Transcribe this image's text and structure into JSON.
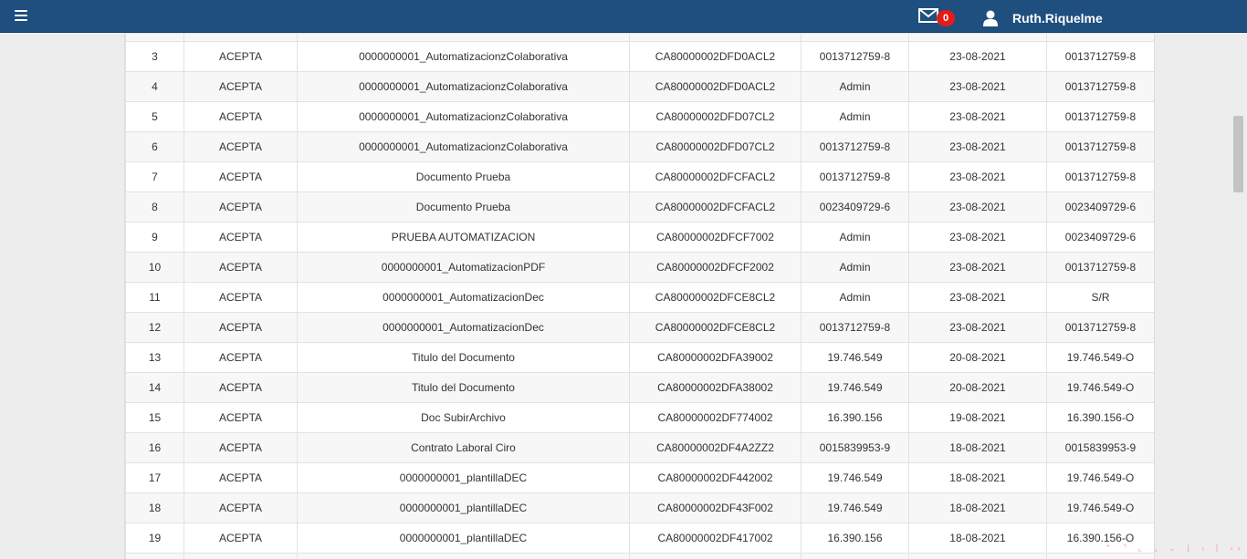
{
  "header": {
    "menu_icon": "hamburger-menu-icon",
    "mail_icon": "envelope-icon",
    "notifications_count": "0",
    "user_icon": "user-icon",
    "username": "Ruth.Riquelme",
    "background_color": "#1e4f7f",
    "badge_color": "#e31b1b"
  },
  "table": {
    "rows": [
      [
        "3",
        "ACEPTA",
        "0000000001_AutomatizacionzColaborativa",
        "CA80000002DFD0ACL2",
        "0013712759-8",
        "23-08-2021",
        "0013712759-8"
      ],
      [
        "4",
        "ACEPTA",
        "0000000001_AutomatizacionzColaborativa",
        "CA80000002DFD0ACL2",
        "Admin",
        "23-08-2021",
        "0013712759-8"
      ],
      [
        "5",
        "ACEPTA",
        "0000000001_AutomatizacionzColaborativa",
        "CA80000002DFD07CL2",
        "Admin",
        "23-08-2021",
        "0013712759-8"
      ],
      [
        "6",
        "ACEPTA",
        "0000000001_AutomatizacionzColaborativa",
        "CA80000002DFD07CL2",
        "0013712759-8",
        "23-08-2021",
        "0013712759-8"
      ],
      [
        "7",
        "ACEPTA",
        "Documento Prueba",
        "CA80000002DFCFACL2",
        "0013712759-8",
        "23-08-2021",
        "0013712759-8"
      ],
      [
        "8",
        "ACEPTA",
        "Documento Prueba",
        "CA80000002DFCFACL2",
        "0023409729-6",
        "23-08-2021",
        "0023409729-6"
      ],
      [
        "9",
        "ACEPTA",
        "PRUEBA AUTOMATIZACION",
        "CA80000002DFCF7002",
        "Admin",
        "23-08-2021",
        "0023409729-6"
      ],
      [
        "10",
        "ACEPTA",
        "0000000001_AutomatizacionPDF",
        "CA80000002DFCF2002",
        "Admin",
        "23-08-2021",
        "0013712759-8"
      ],
      [
        "11",
        "ACEPTA",
        "0000000001_AutomatizacionDec",
        "CA80000002DFCE8CL2",
        "Admin",
        "23-08-2021",
        "S/R"
      ],
      [
        "12",
        "ACEPTA",
        "0000000001_AutomatizacionDec",
        "CA80000002DFCE8CL2",
        "0013712759-8",
        "23-08-2021",
        "0013712759-8"
      ],
      [
        "13",
        "ACEPTA",
        "Titulo del Documento",
        "CA80000002DFA39002",
        "19.746.549",
        "20-08-2021",
        "19.746.549-O"
      ],
      [
        "14",
        "ACEPTA",
        "Titulo del Documento",
        "CA80000002DFA38002",
        "19.746.549",
        "20-08-2021",
        "19.746.549-O"
      ],
      [
        "15",
        "ACEPTA",
        "Doc SubirArchivo",
        "CA80000002DF774002",
        "16.390.156",
        "19-08-2021",
        "16.390.156-O"
      ],
      [
        "16",
        "ACEPTA",
        "Contrato Laboral Ciro",
        "CA80000002DF4A2ZZ2",
        "0015839953-9",
        "18-08-2021",
        "0015839953-9"
      ],
      [
        "17",
        "ACEPTA",
        "0000000001_plantillaDEC",
        "CA80000002DF442002",
        "19.746.549",
        "18-08-2021",
        "19.746.549-O"
      ],
      [
        "18",
        "ACEPTA",
        "0000000001_plantillaDEC",
        "CA80000002DF43F002",
        "19.746.549",
        "18-08-2021",
        "19.746.549-O"
      ],
      [
        "19",
        "ACEPTA",
        "0000000001_plantillaDEC",
        "CA80000002DF417002",
        "16.390.156",
        "18-08-2021",
        "16.390.156-O"
      ]
    ]
  },
  "footer_deco": "⌃ ⌝ ⌞ ⌟ ⌄ ⌊ ‹ ⌈ ‹›"
}
